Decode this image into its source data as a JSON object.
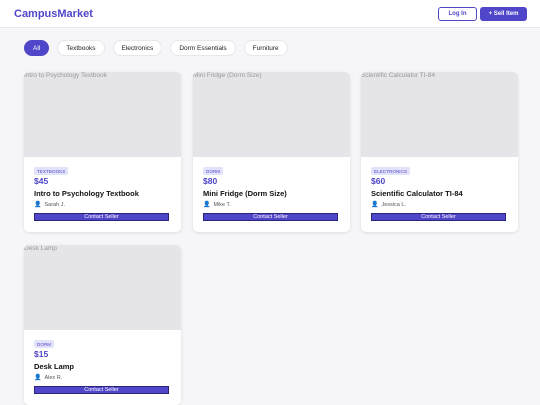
{
  "header": {
    "brand": "CampusMarket",
    "login_label": "Log In",
    "sell_label": "+ Sell Item"
  },
  "filters": [
    "All",
    "Textbooks",
    "Electronics",
    "Dorm Essentials",
    "Furniture"
  ],
  "active_filter": "All",
  "listings": [
    {
      "image_alt": "Intro to Psychology Textbook",
      "category": "TEXTBOOKS",
      "price": "$45",
      "title": "Intro to Psychology Textbook",
      "seller": "Sarah J.",
      "contact_label": "Contact Seller"
    },
    {
      "image_alt": "Mini Fridge (Dorm Size)",
      "category": "DORM",
      "price": "$80",
      "title": "Mini Fridge (Dorm Size)",
      "seller": "Mike T.",
      "contact_label": "Contact Seller"
    },
    {
      "image_alt": "Scientific Calculator TI-84",
      "category": "ELECTRONICS",
      "price": "$60",
      "title": "Scientific Calculator TI-84",
      "seller": "Jessica L.",
      "contact_label": "Contact Seller"
    },
    {
      "image_alt": "Desk Lamp",
      "category": "DORM",
      "price": "$15",
      "title": "Desk Lamp",
      "seller": "Alex R.",
      "contact_label": "Contact Seller"
    }
  ],
  "colors": {
    "accent": "#4f46c9",
    "badge_bg": "#e3e2fb",
    "page_bg": "#f6f6f8"
  },
  "icons": {
    "seller": "person-icon"
  }
}
